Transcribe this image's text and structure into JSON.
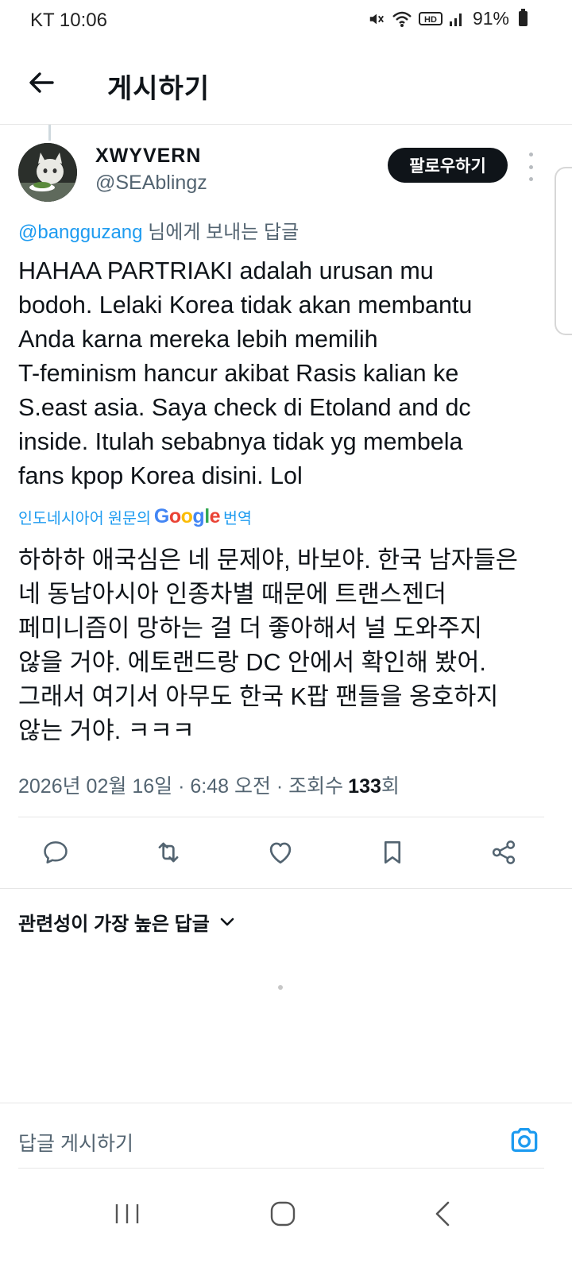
{
  "status_bar": {
    "time": "KT 10:06",
    "hd_label": "HD",
    "battery": "91%",
    "icons": [
      "mute-icon",
      "wifi-icon",
      "hd-icon",
      "signal-icon",
      "battery-icon"
    ]
  },
  "header": {
    "title": "게시하기",
    "back_icon": "arrow-left-icon"
  },
  "author": {
    "name": "XWYVERN",
    "handle": "@SEAblingz",
    "follow_label": "팔로우하기"
  },
  "reply_to": {
    "mention": "@bangguzang",
    "suffix": " 님에게 보내는 답글"
  },
  "tweet": {
    "text": "HAHAA PARTRIAKI adalah urusan mu\nbodoh. Lelaki Korea tidak akan membantu\nAnda karna mereka lebih memilih\nT-feminism hancur akibat Rasis kalian ke\nS.east asia. Saya check di Etoland and dc\ninside. Itulah sebabnya tidak yg membela\nfans kpop Korea disini. Lol",
    "translation_prefix": "인도네시아어 원문의",
    "translation_brand": "Google",
    "translation_suffix": "번역",
    "translated_text": "하하하 애국심은 네 문제야, 바보야. 한국 남자들은\n네 동남아시아 인종차별 때문에 트랜스젠더\n페미니즘이 망하는 걸 더 좋아해서 널 도와주지\n않을 거야. 에토랜드랑 DC 안에서 확인해 봤어.\n그래서 여기서 아무도 한국 K팝 팬들을 옹호하지\n않는 거야. ㅋㅋㅋ"
  },
  "meta": {
    "datetime": "2026년 02월 16일 · 6:48 오전 · 조회수",
    "views": "133",
    "views_suffix": "회"
  },
  "actions": [
    "reply-icon",
    "retweet-icon",
    "like-icon",
    "bookmark-icon",
    "share-icon"
  ],
  "replies": {
    "sort_label": "관련성이 가장 높은 답글"
  },
  "composer": {
    "placeholder": "답글 게시하기"
  },
  "colors": {
    "accent": "#1d9bf0",
    "text": "#0f1419",
    "secondary": "#536471",
    "button": "#0f1419"
  }
}
